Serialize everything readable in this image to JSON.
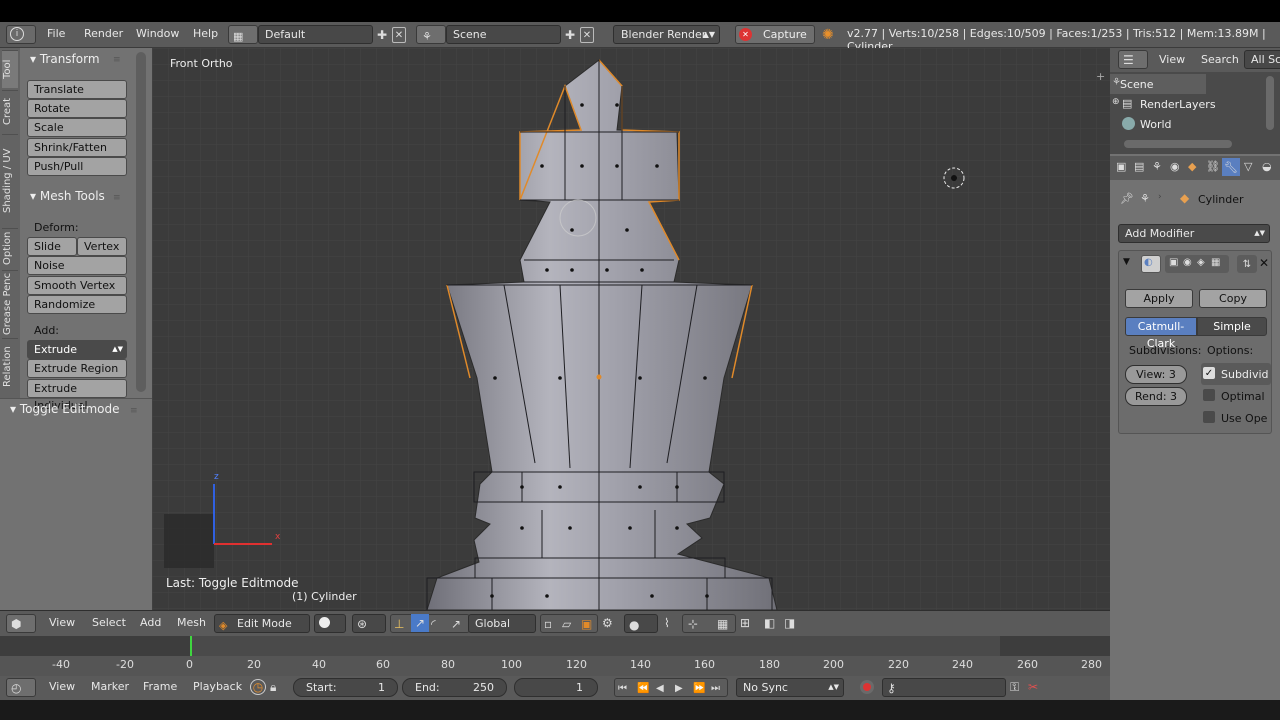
{
  "topbar": {
    "menu": [
      "File",
      "Render",
      "Window",
      "Help"
    ],
    "layout": "Default",
    "scene": "Scene",
    "engine": "Blender Render",
    "capture": "Capture",
    "status": "v2.77 | Verts:10/258 | Edges:10/509 | Faces:1/253 | Tris:512 | Mem:13.89M | Cylinder"
  },
  "toolshelf": {
    "tabs": [
      "Tool",
      "Creat",
      "Shading / UV",
      "Option",
      "Grease Penc",
      "Relation"
    ],
    "transform": {
      "title": "Transform",
      "buttons": [
        "Translate",
        "Rotate",
        "Scale",
        "Shrink/Fatten",
        "Push/Pull"
      ]
    },
    "meshtools": {
      "title": "Mesh Tools",
      "deform_label": "Deform:",
      "slide_edge": "Slide Ed",
      "vertex": "Vertex",
      "noise": "Noise",
      "smooth_vertex": "Smooth Vertex",
      "randomize": "Randomize",
      "add_label": "Add:",
      "extrude": "Extrude",
      "extrude_region": "Extrude Region",
      "extrude_individual": "Extrude Individual"
    },
    "toggle_editmode": "Toggle Editmode"
  },
  "viewport": {
    "view_label": "Front Ortho",
    "last_op": "Last: Toggle Editmode",
    "object_label": "(1) Cylinder",
    "axis_x": "x",
    "axis_z": "z"
  },
  "view3d_header": {
    "menus": [
      "View",
      "Select",
      "Add",
      "Mesh"
    ],
    "mode": "Edit Mode",
    "orientation": "Global"
  },
  "timeline": {
    "ticks": [
      "-40",
      "-20",
      "0",
      "20",
      "40",
      "60",
      "80",
      "100",
      "120",
      "140",
      "160",
      "180",
      "200",
      "220",
      "240",
      "260",
      "280"
    ],
    "menus": [
      "View",
      "Marker",
      "Frame",
      "Playback"
    ],
    "start_label": "Start:",
    "start": "1",
    "end_label": "End:",
    "end": "250",
    "current": "1",
    "sync": "No Sync"
  },
  "outliner": {
    "menus": [
      "View",
      "Search"
    ],
    "filter": "All Sc",
    "items": [
      "Scene",
      "RenderLayers",
      "World"
    ]
  },
  "properties": {
    "breadcrumb": "Cylinder",
    "add_modifier": "Add Modifier",
    "apply": "Apply",
    "copy": "Copy",
    "catmull": "Catmull-Clark",
    "simple": "Simple",
    "subdivisions_label": "Subdivisions:",
    "options_label": "Options:",
    "view_field": "View:",
    "view_val": "3",
    "rend_field": "Rend:",
    "rend_val": "3",
    "opt_subdiv": "Subdivid",
    "opt_optimal": "Optimal",
    "opt_useopen": "Use Ope"
  },
  "colors": {
    "mesh": "#8c8c96",
    "selection": "#e08a2a",
    "timeline_cursor": "#3fd63f"
  }
}
